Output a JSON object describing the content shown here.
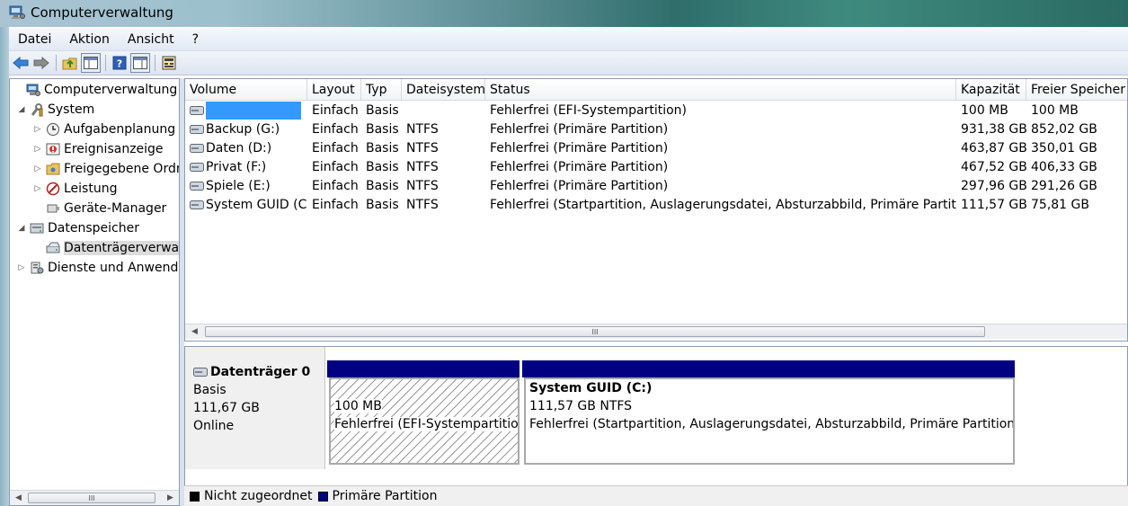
{
  "window": {
    "title": "Computerverwaltung"
  },
  "menu": [
    "Datei",
    "Aktion",
    "Ansicht",
    "?"
  ],
  "tree": [
    {
      "label": "Computerverwaltung (Lokal)",
      "level": 0,
      "expander": "",
      "icon": "computer-management-icon"
    },
    {
      "label": "System",
      "level": 1,
      "expander": "◢",
      "icon": "tools-icon"
    },
    {
      "label": "Aufgabenplanung",
      "level": 2,
      "expander": "▷",
      "icon": "clock-icon"
    },
    {
      "label": "Ereignisanzeige",
      "level": 2,
      "expander": "▷",
      "icon": "event-viewer-icon"
    },
    {
      "label": "Freigegebene Ordner",
      "level": 2,
      "expander": "▷",
      "icon": "shared-folder-icon"
    },
    {
      "label": "Leistung",
      "level": 2,
      "expander": "▷",
      "icon": "performance-icon"
    },
    {
      "label": "Geräte-Manager",
      "level": 2,
      "expander": "",
      "icon": "device-manager-icon"
    },
    {
      "label": "Datenspeicher",
      "level": 1,
      "expander": "◢",
      "icon": "storage-icon"
    },
    {
      "label": "Datenträgerverwaltung",
      "level": 2,
      "expander": "",
      "icon": "disk-management-icon",
      "selected": true
    },
    {
      "label": "Dienste und Anwendungen",
      "level": 1,
      "expander": "▷",
      "icon": "services-icon"
    }
  ],
  "list": {
    "columns": [
      "Volume",
      "Layout",
      "Typ",
      "Dateisystem",
      "Status",
      "Kapazität",
      "Freier Speicher"
    ],
    "rows": [
      {
        "volume": "",
        "layout": "Einfach",
        "typ": "Basis",
        "fs": "",
        "status": "Fehlerfrei (EFI-Systempartition)",
        "cap": "100 MB",
        "free": "100 MB",
        "highlight": true
      },
      {
        "volume": "Backup (G:)",
        "layout": "Einfach",
        "typ": "Basis",
        "fs": "NTFS",
        "status": "Fehlerfrei (Primäre Partition)",
        "cap": "931,38 GB",
        "free": "852,02 GB"
      },
      {
        "volume": "Daten (D:)",
        "layout": "Einfach",
        "typ": "Basis",
        "fs": "NTFS",
        "status": "Fehlerfrei (Primäre Partition)",
        "cap": "463,87 GB",
        "free": "350,01 GB"
      },
      {
        "volume": "Privat (F:)",
        "layout": "Einfach",
        "typ": "Basis",
        "fs": "NTFS",
        "status": "Fehlerfrei (Primäre Partition)",
        "cap": "467,52 GB",
        "free": "406,33 GB"
      },
      {
        "volume": "Spiele (E:)",
        "layout": "Einfach",
        "typ": "Basis",
        "fs": "NTFS",
        "status": "Fehlerfrei (Primäre Partition)",
        "cap": "297,96 GB",
        "free": "291,26 GB"
      },
      {
        "volume": "System GUID (C:)",
        "layout": "Einfach",
        "typ": "Basis",
        "fs": "NTFS",
        "status": "Fehlerfrei (Startpartition, Auslagerungsdatei, Absturzabbild, Primäre Partition)",
        "cap": "111,57 GB",
        "free": "75,81 GB"
      }
    ]
  },
  "scroll": {
    "grip": "III"
  },
  "disk": {
    "name": "Datenträger 0",
    "type": "Basis",
    "size": "111,67 GB",
    "state": "Online",
    "efi": {
      "size": "100 MB",
      "status": "Fehlerfrei (EFI-Systempartition)"
    },
    "sys": {
      "name": "System GUID  (C:)",
      "size": "111,57 GB NTFS",
      "status": "Fehlerfrei (Startpartition, Auslagerungsdatei, Absturzabbild, Primäre Partition)"
    }
  },
  "legend": {
    "unallocated": "Nicht zugeordnet",
    "primary": "Primäre Partition"
  },
  "colors": {
    "primary": "#000080",
    "selection": "#3399ff",
    "unallocated": "#000000"
  }
}
